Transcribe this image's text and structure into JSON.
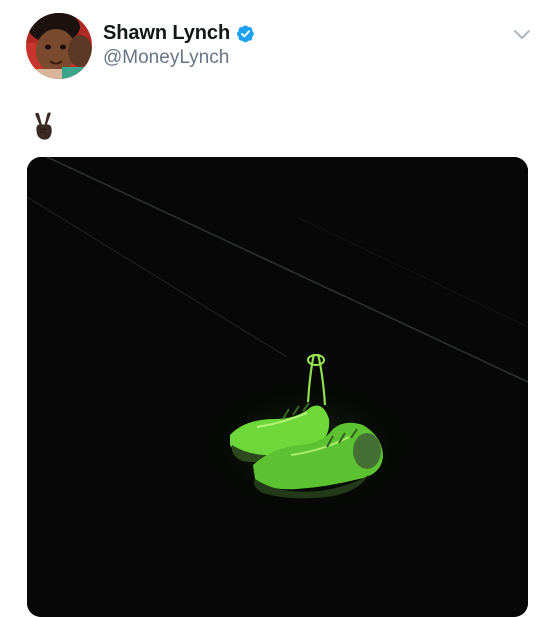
{
  "tweet": {
    "author": {
      "display_name": "Shawn Lynch",
      "handle": "@MoneyLynch",
      "verified": true,
      "avatar_icon": "profile-photo"
    },
    "text": "✌🏿",
    "media": {
      "type": "photo",
      "icon": "shoes-hanging-on-power-line-photo"
    },
    "menu_icon": "chevron-down-icon"
  },
  "colors": {
    "verified_blue": "#1da1f2",
    "handle_gray": "#657786",
    "name_black": "#14171a",
    "chevron_gray": "#aab8c2"
  }
}
